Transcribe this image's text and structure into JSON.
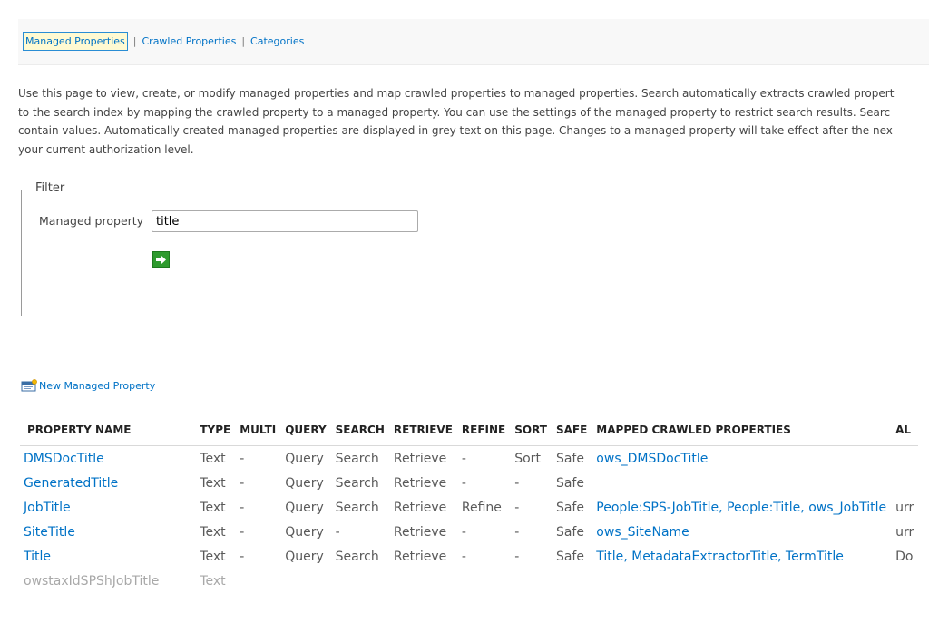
{
  "nav": {
    "tabs": [
      {
        "label": "Managed Properties",
        "selected": true
      },
      {
        "label": "Crawled Properties",
        "selected": false
      },
      {
        "label": "Categories",
        "selected": false
      }
    ],
    "separator": "|"
  },
  "description": {
    "lines": [
      "Use this page to view, create, or modify managed properties and map crawled properties to managed properties. Search automatically extracts crawled propert",
      "to the search index by mapping the crawled property to a managed property. You can use the settings of the managed property to restrict search results. Searc",
      "contain values. Automatically created managed properties are displayed in grey text on this page. Changes to a managed property will take effect after the nex",
      "your current authorization level."
    ]
  },
  "filter": {
    "legend": "Filter",
    "label": "Managed property",
    "value": "title"
  },
  "new_property": {
    "label": "New Managed Property"
  },
  "table": {
    "headers": [
      "PROPERTY NAME",
      "TYPE",
      "MULTI",
      "QUERY",
      "SEARCH",
      "RETRIEVE",
      "REFINE",
      "SORT",
      "SAFE",
      "MAPPED CRAWLED PROPERTIES",
      "AL"
    ],
    "rows": [
      {
        "name": "DMSDocTitle",
        "type": "Text",
        "multi": "-",
        "query": "Query",
        "search": "Search",
        "retrieve": "Retrieve",
        "refine": "-",
        "sort": "Sort",
        "safe": "Safe",
        "mapped": [
          "ows_DMSDocTitle"
        ],
        "alias": "",
        "auto": false
      },
      {
        "name": "GeneratedTitle",
        "type": "Text",
        "multi": "-",
        "query": "Query",
        "search": "Search",
        "retrieve": "Retrieve",
        "refine": "-",
        "sort": "-",
        "safe": "Safe",
        "mapped": [],
        "alias": "",
        "auto": false
      },
      {
        "name": "JobTitle",
        "type": "Text",
        "multi": "-",
        "query": "Query",
        "search": "Search",
        "retrieve": "Retrieve",
        "refine": "Refine",
        "sort": "-",
        "safe": "Safe",
        "mapped": [
          "People:SPS-JobTitle",
          "People:Title",
          "ows_JobTitle"
        ],
        "alias": "urr",
        "auto": false
      },
      {
        "name": "SiteTitle",
        "type": "Text",
        "multi": "-",
        "query": "Query",
        "search": "-",
        "retrieve": "Retrieve",
        "refine": "-",
        "sort": "-",
        "safe": "Safe",
        "mapped": [
          "ows_SiteName"
        ],
        "alias": "urr",
        "auto": false
      },
      {
        "name": "Title",
        "type": "Text",
        "multi": "-",
        "query": "Query",
        "search": "Search",
        "retrieve": "Retrieve",
        "refine": "-",
        "sort": "-",
        "safe": "Safe",
        "mapped": [
          "Title",
          "MetadataExtractorTitle",
          "TermTitle"
        ],
        "alias": "Do",
        "auto": false
      },
      {
        "name": "owstaxIdSPShJobTitle",
        "type": "Text",
        "multi": "",
        "query": "",
        "search": "",
        "retrieve": "",
        "refine": "",
        "sort": "",
        "safe": "",
        "mapped": [],
        "alias": "",
        "auto": true
      }
    ]
  },
  "colors": {
    "link": "#0072c6",
    "selected_tab_bg": "#fffad2",
    "auto_text": "#a8a8a8",
    "go_button": "#2e9b2e"
  },
  "icons": {
    "go": "arrow-right-icon",
    "new_property": "new-property-icon"
  }
}
